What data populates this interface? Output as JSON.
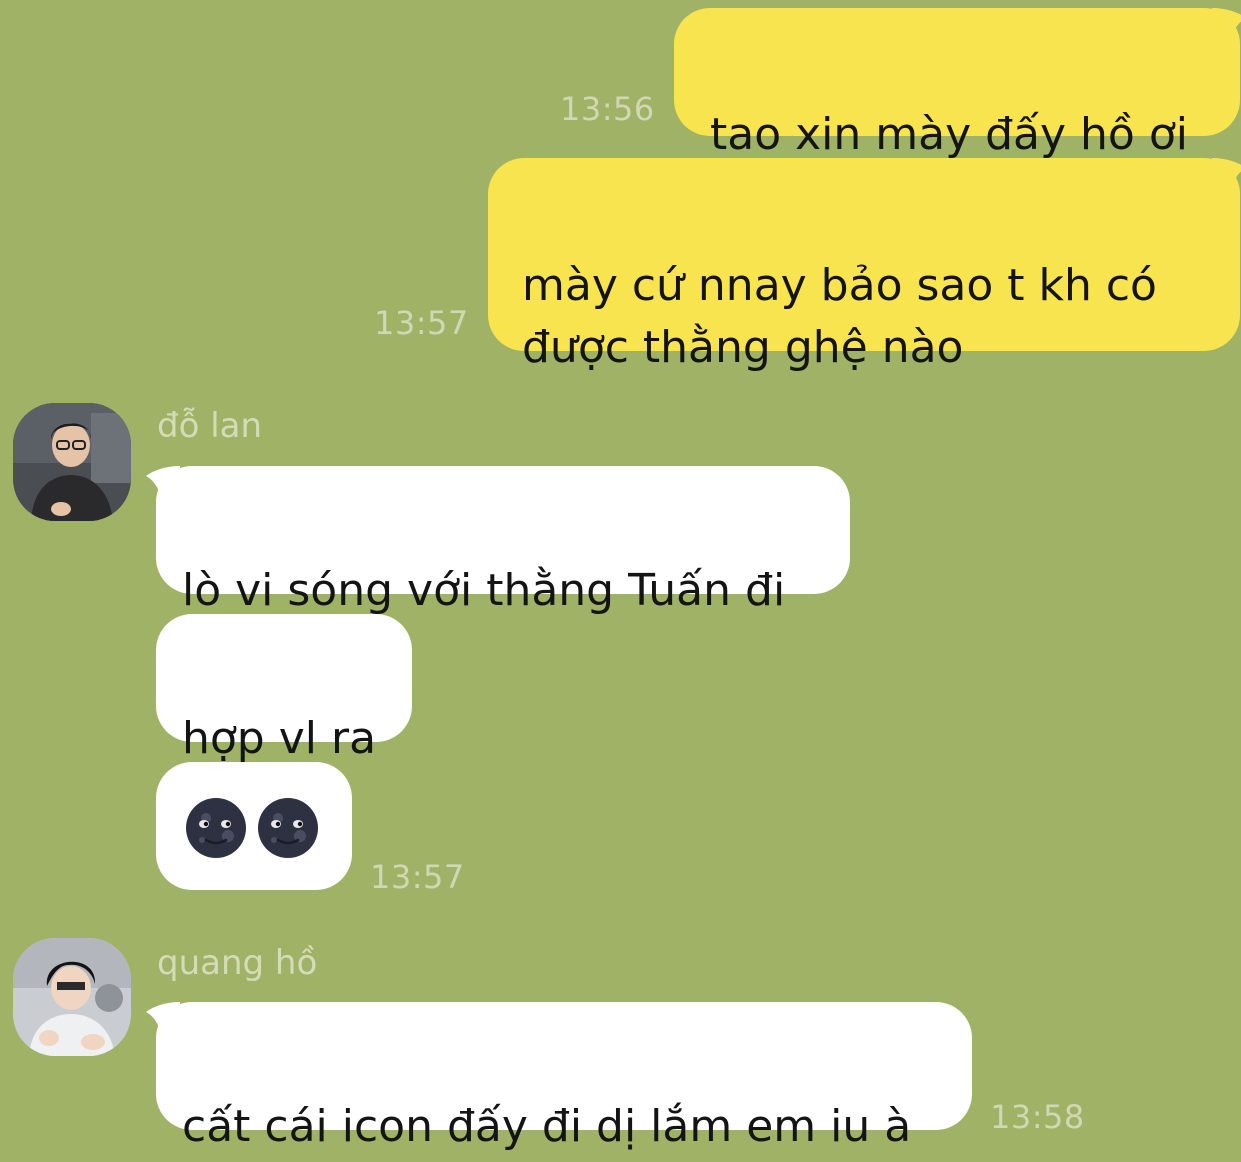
{
  "colors": {
    "background": "#9fb265",
    "outgoing_bubble": "#f8e44f",
    "incoming_bubble": "#ffffff",
    "timestamp": "#cfd8b4",
    "sender_name": "#d3dcb9"
  },
  "messages_out": [
    {
      "text": "tao xin mày đấy hồ ơi",
      "time": "13:56"
    },
    {
      "text": "mày cứ nnay bảo sao t kh có\nđược thằng ghệ nào",
      "time": "13:57"
    }
  ],
  "group_lan": {
    "sender": "đỗ lan",
    "avatar_icon": "user-photo-avatar",
    "messages": [
      {
        "text": "lò vi sóng với thằng Tuấn đi"
      },
      {
        "text": "hợp vl ra"
      },
      {
        "emoji": [
          "new-moon-face-icon",
          "new-moon-face-icon"
        ],
        "time": "13:57"
      }
    ]
  },
  "group_quang": {
    "sender": "quang hồ",
    "avatar_icon": "user-photo-avatar",
    "messages": [
      {
        "text": "cất cái icon đấy đi dị lắm em iu à",
        "time": "13:58"
      }
    ]
  }
}
